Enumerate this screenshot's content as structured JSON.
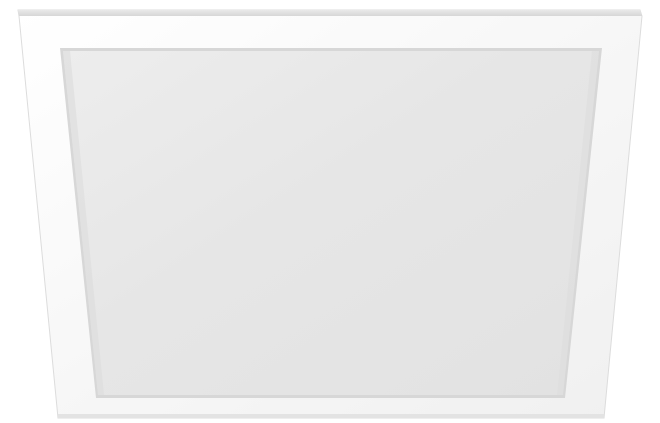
{
  "image": {
    "subject": "ceiling-panel-light",
    "colors": {
      "background": "#ffffff",
      "frame": "#f6f6f6",
      "frame_edge": "#d9d9d9",
      "frame_shadow": "#e8e8e8",
      "diffuser": "#e6e6e6",
      "diffuser_inner_edge": "#cfcfcf"
    }
  }
}
